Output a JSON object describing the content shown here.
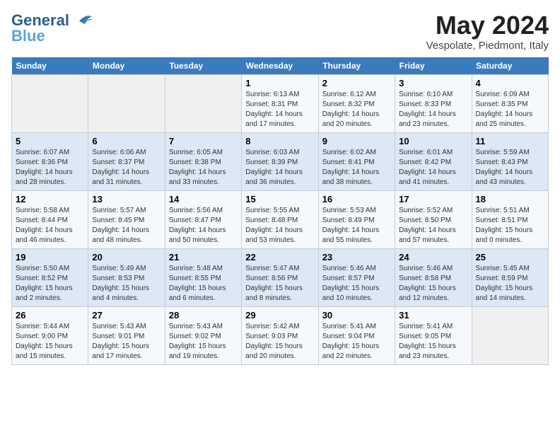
{
  "logo": {
    "line1": "General",
    "line2": "Blue"
  },
  "title": "May 2024",
  "subtitle": "Vespolate, Piedmont, Italy",
  "headers": [
    "Sunday",
    "Monday",
    "Tuesday",
    "Wednesday",
    "Thursday",
    "Friday",
    "Saturday"
  ],
  "weeks": [
    [
      {
        "day": "",
        "info": ""
      },
      {
        "day": "",
        "info": ""
      },
      {
        "day": "",
        "info": ""
      },
      {
        "day": "1",
        "info": "Sunrise: 6:13 AM\nSunset: 8:31 PM\nDaylight: 14 hours\nand 17 minutes."
      },
      {
        "day": "2",
        "info": "Sunrise: 6:12 AM\nSunset: 8:32 PM\nDaylight: 14 hours\nand 20 minutes."
      },
      {
        "day": "3",
        "info": "Sunrise: 6:10 AM\nSunset: 8:33 PM\nDaylight: 14 hours\nand 23 minutes."
      },
      {
        "day": "4",
        "info": "Sunrise: 6:09 AM\nSunset: 8:35 PM\nDaylight: 14 hours\nand 25 minutes."
      }
    ],
    [
      {
        "day": "5",
        "info": "Sunrise: 6:07 AM\nSunset: 8:36 PM\nDaylight: 14 hours\nand 28 minutes."
      },
      {
        "day": "6",
        "info": "Sunrise: 6:06 AM\nSunset: 8:37 PM\nDaylight: 14 hours\nand 31 minutes."
      },
      {
        "day": "7",
        "info": "Sunrise: 6:05 AM\nSunset: 8:38 PM\nDaylight: 14 hours\nand 33 minutes."
      },
      {
        "day": "8",
        "info": "Sunrise: 6:03 AM\nSunset: 8:39 PM\nDaylight: 14 hours\nand 36 minutes."
      },
      {
        "day": "9",
        "info": "Sunrise: 6:02 AM\nSunset: 8:41 PM\nDaylight: 14 hours\nand 38 minutes."
      },
      {
        "day": "10",
        "info": "Sunrise: 6:01 AM\nSunset: 8:42 PM\nDaylight: 14 hours\nand 41 minutes."
      },
      {
        "day": "11",
        "info": "Sunrise: 5:59 AM\nSunset: 8:43 PM\nDaylight: 14 hours\nand 43 minutes."
      }
    ],
    [
      {
        "day": "12",
        "info": "Sunrise: 5:58 AM\nSunset: 8:44 PM\nDaylight: 14 hours\nand 46 minutes."
      },
      {
        "day": "13",
        "info": "Sunrise: 5:57 AM\nSunset: 8:45 PM\nDaylight: 14 hours\nand 48 minutes."
      },
      {
        "day": "14",
        "info": "Sunrise: 5:56 AM\nSunset: 8:47 PM\nDaylight: 14 hours\nand 50 minutes."
      },
      {
        "day": "15",
        "info": "Sunrise: 5:55 AM\nSunset: 8:48 PM\nDaylight: 14 hours\nand 53 minutes."
      },
      {
        "day": "16",
        "info": "Sunrise: 5:53 AM\nSunset: 8:49 PM\nDaylight: 14 hours\nand 55 minutes."
      },
      {
        "day": "17",
        "info": "Sunrise: 5:52 AM\nSunset: 8:50 PM\nDaylight: 14 hours\nand 57 minutes."
      },
      {
        "day": "18",
        "info": "Sunrise: 5:51 AM\nSunset: 8:51 PM\nDaylight: 15 hours\nand 0 minutes."
      }
    ],
    [
      {
        "day": "19",
        "info": "Sunrise: 5:50 AM\nSunset: 8:52 PM\nDaylight: 15 hours\nand 2 minutes."
      },
      {
        "day": "20",
        "info": "Sunrise: 5:49 AM\nSunset: 8:53 PM\nDaylight: 15 hours\nand 4 minutes."
      },
      {
        "day": "21",
        "info": "Sunrise: 5:48 AM\nSunset: 8:55 PM\nDaylight: 15 hours\nand 6 minutes."
      },
      {
        "day": "22",
        "info": "Sunrise: 5:47 AM\nSunset: 8:56 PM\nDaylight: 15 hours\nand 8 minutes."
      },
      {
        "day": "23",
        "info": "Sunrise: 5:46 AM\nSunset: 8:57 PM\nDaylight: 15 hours\nand 10 minutes."
      },
      {
        "day": "24",
        "info": "Sunrise: 5:46 AM\nSunset: 8:58 PM\nDaylight: 15 hours\nand 12 minutes."
      },
      {
        "day": "25",
        "info": "Sunrise: 5:45 AM\nSunset: 8:59 PM\nDaylight: 15 hours\nand 14 minutes."
      }
    ],
    [
      {
        "day": "26",
        "info": "Sunrise: 5:44 AM\nSunset: 9:00 PM\nDaylight: 15 hours\nand 15 minutes."
      },
      {
        "day": "27",
        "info": "Sunrise: 5:43 AM\nSunset: 9:01 PM\nDaylight: 15 hours\nand 17 minutes."
      },
      {
        "day": "28",
        "info": "Sunrise: 5:43 AM\nSunset: 9:02 PM\nDaylight: 15 hours\nand 19 minutes."
      },
      {
        "day": "29",
        "info": "Sunrise: 5:42 AM\nSunset: 9:03 PM\nDaylight: 15 hours\nand 20 minutes."
      },
      {
        "day": "30",
        "info": "Sunrise: 5:41 AM\nSunset: 9:04 PM\nDaylight: 15 hours\nand 22 minutes."
      },
      {
        "day": "31",
        "info": "Sunrise: 5:41 AM\nSunset: 9:05 PM\nDaylight: 15 hours\nand 23 minutes."
      },
      {
        "day": "",
        "info": ""
      }
    ]
  ]
}
